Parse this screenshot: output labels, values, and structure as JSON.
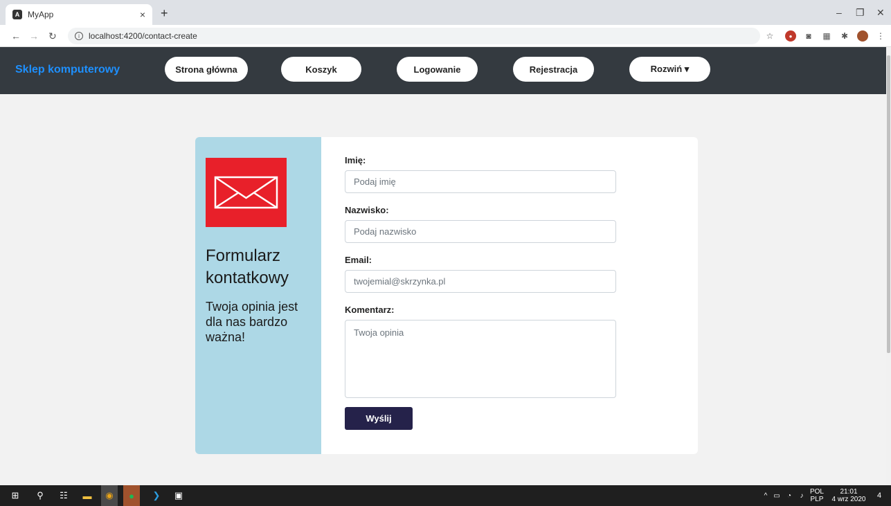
{
  "browser": {
    "tab_title": "MyApp",
    "tab_close": "×",
    "new_tab": "+",
    "url": "localhost:4200/contact-create",
    "minimize": "–",
    "maximize": "❐",
    "close": "✕"
  },
  "navbar": {
    "brand": "Sklep komputerowy",
    "items": [
      "Strona główna",
      "Koszyk",
      "Logowanie",
      "Rejestracja",
      "Rozwiń ▾"
    ]
  },
  "contact": {
    "title": "Formularz kontatkowy",
    "subtitle": "Twoja opinia jest dla nas bardzo ważna!",
    "fields": {
      "first_name_label": "Imię:",
      "first_name_placeholder": "Podaj imię",
      "last_name_label": "Nazwisko:",
      "last_name_placeholder": "Podaj nazwisko",
      "email_label": "Email:",
      "email_placeholder": "twojemial@skrzynka.pl",
      "comment_label": "Komentarz:",
      "comment_placeholder": "Twoja opinia"
    },
    "submit_label": "Wyślij"
  },
  "taskbar": {
    "lang_top": "POL",
    "lang_bottom": "PLP",
    "time": "21:01",
    "date": "4 wrz 2020",
    "notifications": "4"
  },
  "colors": {
    "navbar_bg": "#343a40",
    "brand": "#1e90ff",
    "card_left_bg": "#add8e6",
    "mail_icon_bg": "#e8202a",
    "submit_bg": "#25224a"
  }
}
